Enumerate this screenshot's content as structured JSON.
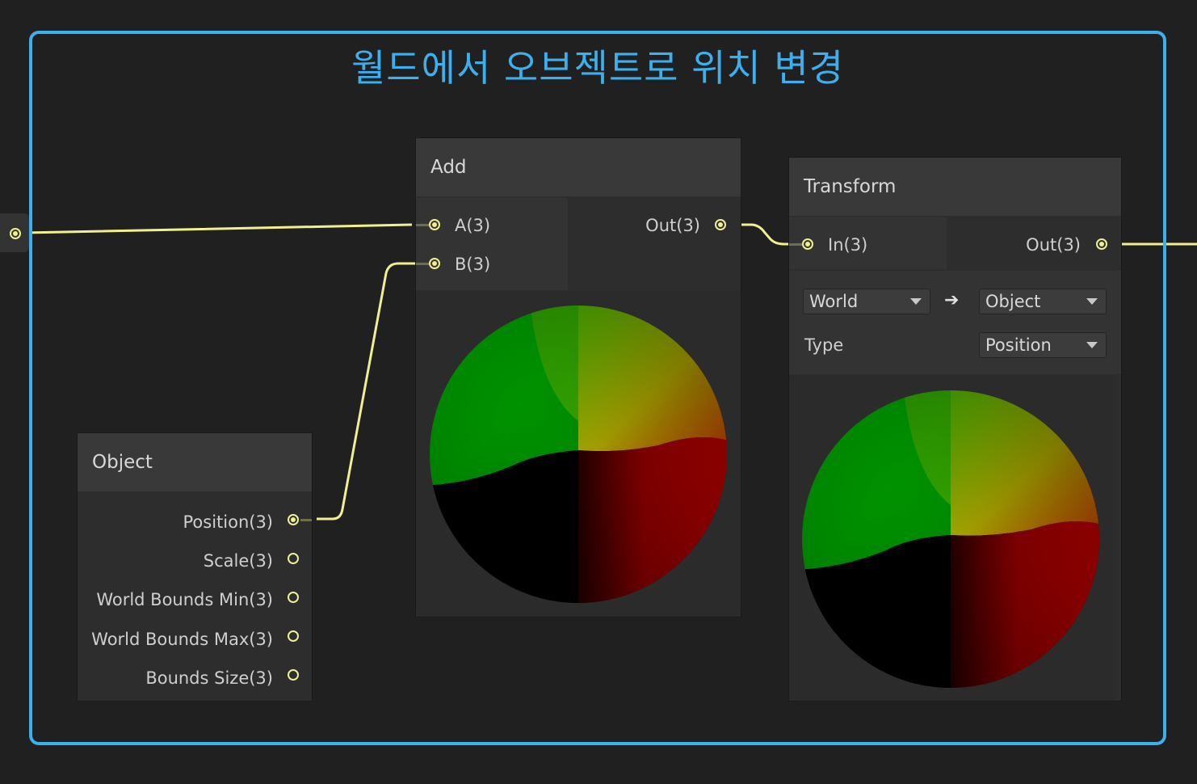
{
  "group": {
    "title": "월드에서 오브젝트로 위치 변경"
  },
  "add_node": {
    "title": "Add",
    "inputs": [
      "A(3)",
      "B(3)"
    ],
    "output": "Out(3)"
  },
  "transform_node": {
    "title": "Transform",
    "input": "In(3)",
    "output": "Out(3)",
    "from_space": "World",
    "arrow": "➔",
    "to_space": "Object",
    "type_label": "Type",
    "type_value": "Position"
  },
  "object_node": {
    "title": "Object",
    "outputs": [
      "Position(3)",
      "Scale(3)",
      "World Bounds Min(3)",
      "World Bounds Max(3)",
      "Bounds Size(3)"
    ]
  },
  "colors": {
    "group_border": "#3cb0ef",
    "wire": "#f0f090",
    "background": "#202020"
  }
}
